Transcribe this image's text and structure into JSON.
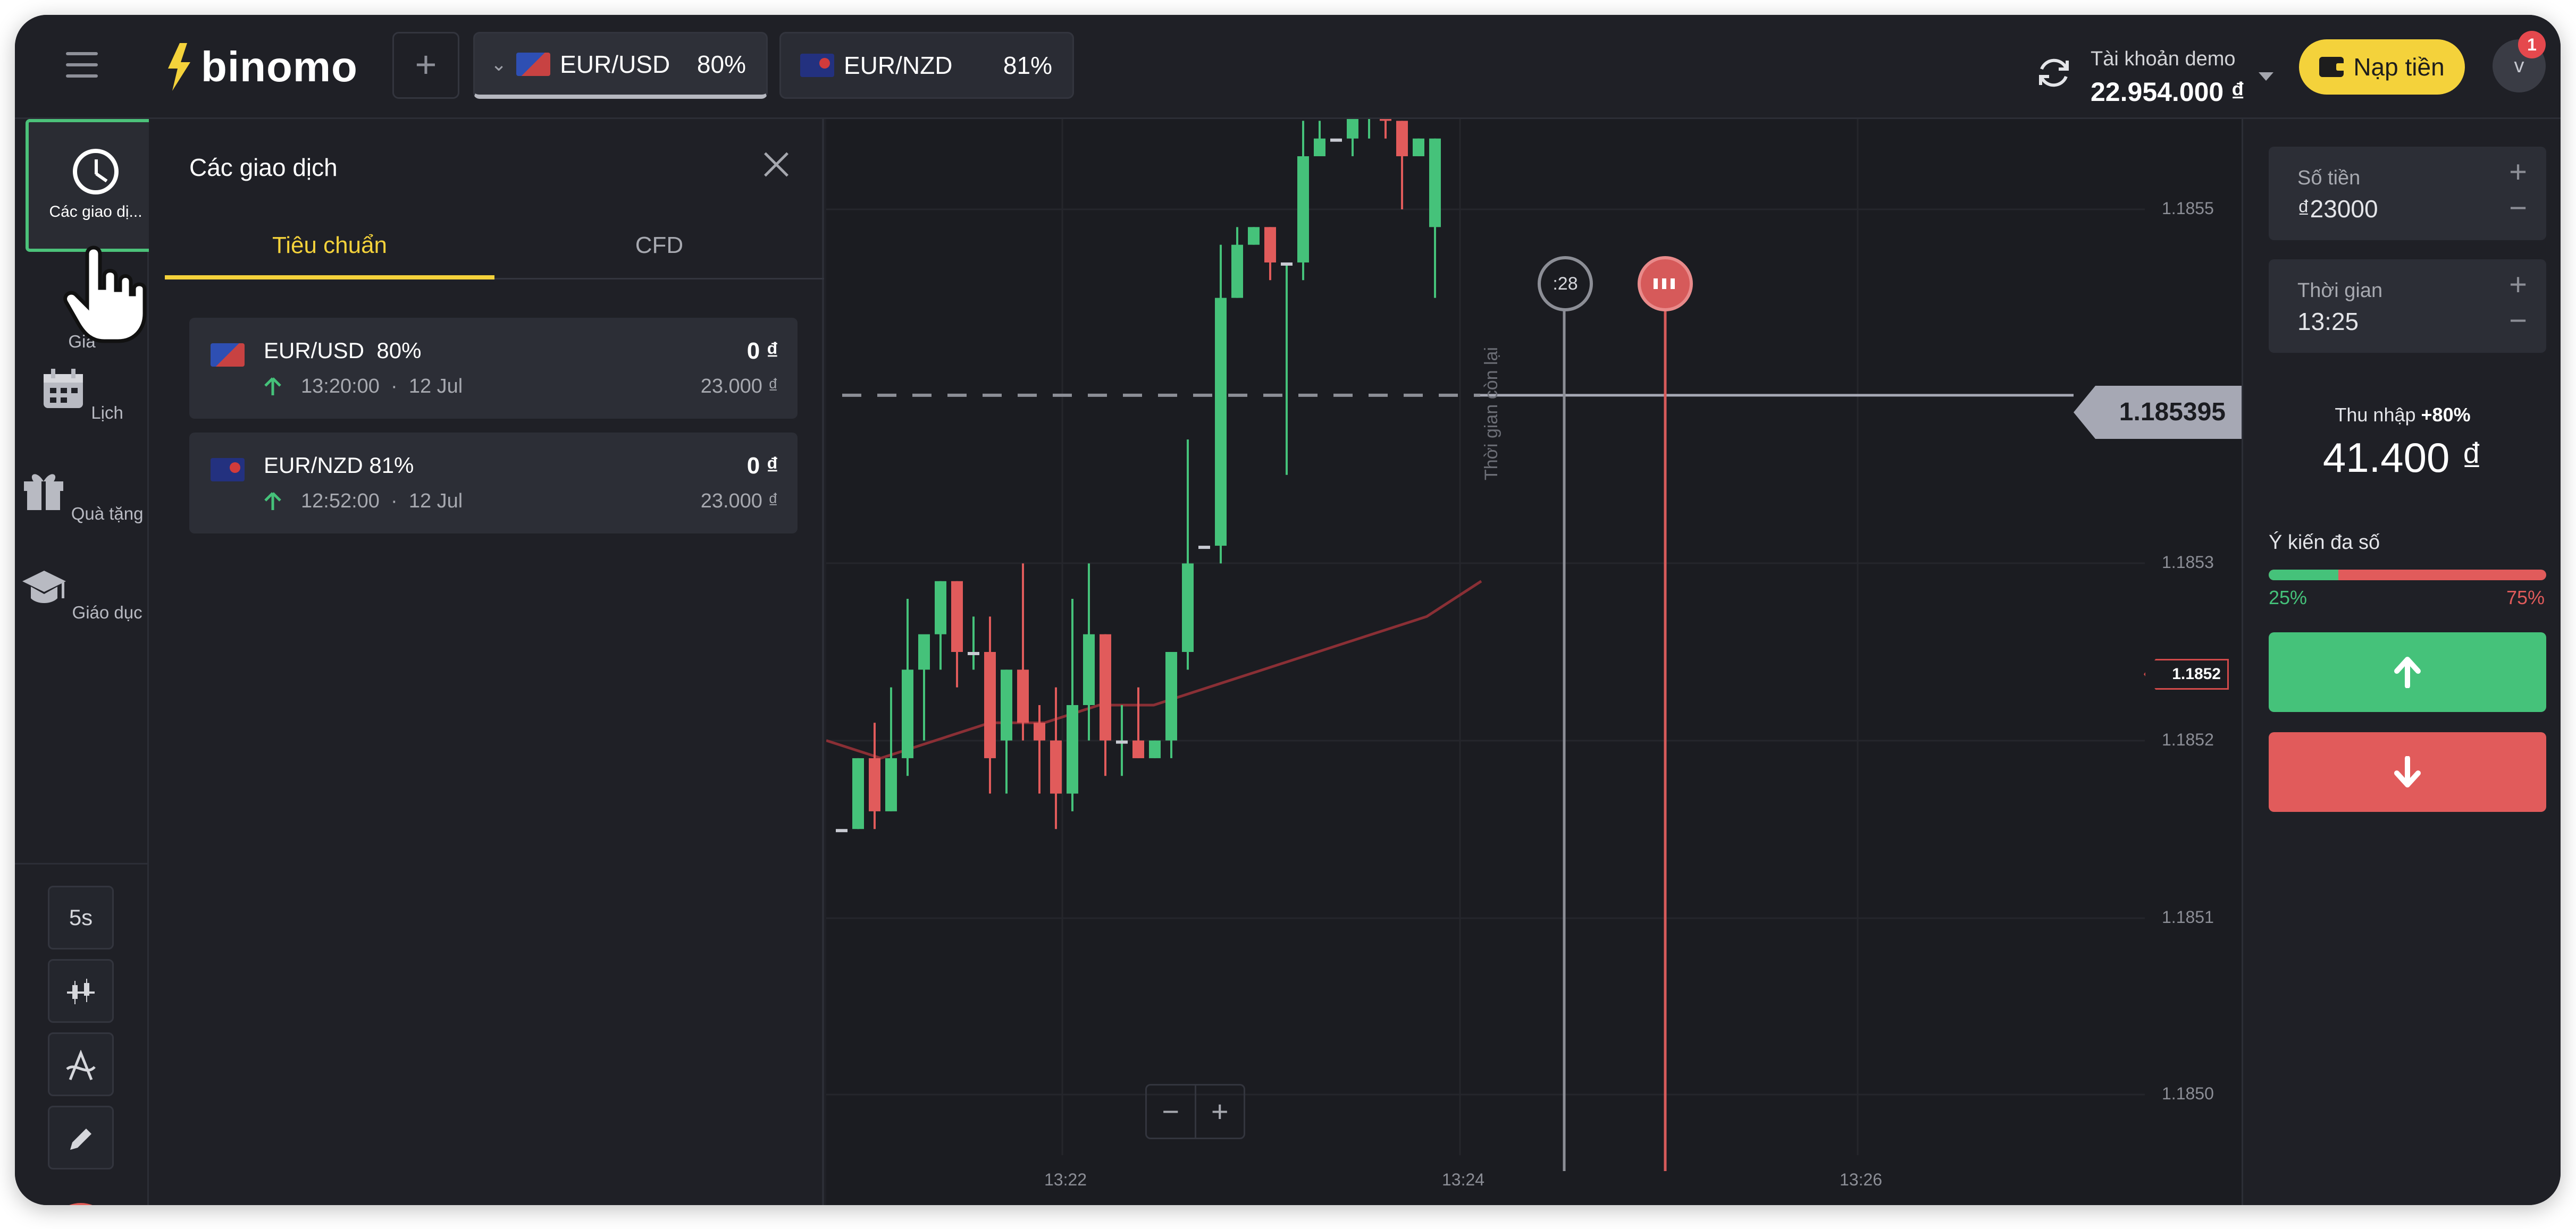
{
  "header": {
    "logo_text": "binomo",
    "add_tab_label": "+",
    "tabs": [
      {
        "asset": "EUR/USD",
        "payout": "80%",
        "active": true
      },
      {
        "asset": "EUR/NZD",
        "payout": "81%",
        "active": false
      }
    ],
    "account_label": "Tài khoản demo",
    "balance": "22.954.000 ₫",
    "deposit_label": "Nạp tiền",
    "avatar_initial": "v",
    "notification_count": "1"
  },
  "sidebar": {
    "active_item": "Các giao dị...",
    "items": [
      {
        "label": "Gia",
        "icon": "trades-icon"
      },
      {
        "label": "Lịch",
        "icon": "calendar-icon"
      },
      {
        "label": "Quà tặng",
        "icon": "gift-icon"
      },
      {
        "label": "Giáo dục",
        "icon": "education-icon"
      }
    ],
    "tools": [
      {
        "label": "5s",
        "icon": "timeframe"
      },
      {
        "label": "",
        "icon": "candles-icon"
      },
      {
        "label": "",
        "icon": "indicators-icon"
      },
      {
        "label": "",
        "icon": "pencil-icon"
      }
    ],
    "help_label": "?"
  },
  "trades_panel": {
    "title": "Các giao dịch",
    "tabs": [
      "Tiêu chuẩn",
      "CFD"
    ],
    "trades": [
      {
        "asset": "EUR/USD",
        "payout": "80%",
        "time": "13:20:00",
        "date": "12 Jul",
        "profit": "0 ₫",
        "amount": "23.000 ₫"
      },
      {
        "asset": "EUR/NZD",
        "payout": "81%",
        "time": "12:52:00",
        "date": "12 Jul",
        "profit": "0 ₫",
        "amount": "23.000 ₫"
      }
    ]
  },
  "chart": {
    "current_price": "1.185395",
    "ma_label": "1.1852",
    "y_labels": [
      "1.1855",
      "1.1853",
      "1.1852",
      "1.1851",
      "1.1850"
    ],
    "x_labels": [
      "13:22",
      "13:24",
      "13:26"
    ],
    "timer_badge": ":28",
    "timer_caption": "Thời gian còn lại",
    "zoom_out": "−",
    "zoom_in": "+",
    "colors": {
      "up": "#45c27a",
      "down": "#e15b5b",
      "ma": "#8a2f35"
    }
  },
  "chart_data": {
    "type": "candlestick",
    "y_ticks": [
      1.1855,
      1.1853,
      1.1852,
      1.1851,
      1.185
    ],
    "x_ticks": [
      "13:22",
      "13:24",
      "13:26"
    ],
    "candles": [
      {
        "o": 1.18515,
        "h": 1.18515,
        "l": 1.18515,
        "c": 1.18515
      },
      {
        "o": 1.18515,
        "h": 1.18519,
        "l": 1.18515,
        "c": 1.18519
      },
      {
        "o": 1.18519,
        "h": 1.18521,
        "l": 1.18515,
        "c": 1.18516
      },
      {
        "o": 1.18516,
        "h": 1.18523,
        "l": 1.18516,
        "c": 1.18519
      },
      {
        "o": 1.18519,
        "h": 1.18528,
        "l": 1.18518,
        "c": 1.18524
      },
      {
        "o": 1.18524,
        "h": 1.18525,
        "l": 1.1852,
        "c": 1.18526
      },
      {
        "o": 1.18526,
        "h": 1.18529,
        "l": 1.18524,
        "c": 1.18529
      },
      {
        "o": 1.18529,
        "h": 1.18529,
        "l": 1.18523,
        "c": 1.18525
      },
      {
        "o": 1.18525,
        "h": 1.18527,
        "l": 1.18524,
        "c": 1.18525
      },
      {
        "o": 1.18525,
        "h": 1.18527,
        "l": 1.18517,
        "c": 1.18519
      },
      {
        "o": 1.1852,
        "h": 1.18524,
        "l": 1.18517,
        "c": 1.18524
      },
      {
        "o": 1.18524,
        "h": 1.1853,
        "l": 1.1852,
        "c": 1.18521
      },
      {
        "o": 1.18521,
        "h": 1.18522,
        "l": 1.18517,
        "c": 1.1852
      },
      {
        "o": 1.1852,
        "h": 1.18523,
        "l": 1.18515,
        "c": 1.18517
      },
      {
        "o": 1.18517,
        "h": 1.18528,
        "l": 1.18516,
        "c": 1.18522
      },
      {
        "o": 1.18522,
        "h": 1.1853,
        "l": 1.1852,
        "c": 1.18526
      },
      {
        "o": 1.18526,
        "h": 1.18526,
        "l": 1.18518,
        "c": 1.1852
      },
      {
        "o": 1.1852,
        "h": 1.18522,
        "l": 1.18518,
        "c": 1.1852
      },
      {
        "o": 1.1852,
        "h": 1.18523,
        "l": 1.18519,
        "c": 1.18519
      },
      {
        "o": 1.18519,
        "h": 1.1852,
        "l": 1.18519,
        "c": 1.1852
      },
      {
        "o": 1.1852,
        "h": 1.18524,
        "l": 1.18519,
        "c": 1.18525
      },
      {
        "o": 1.18525,
        "h": 1.18537,
        "l": 1.18524,
        "c": 1.1853
      },
      {
        "o": 1.18531,
        "h": 1.18531,
        "l": 1.18531,
        "c": 1.18531
      },
      {
        "o": 1.18531,
        "h": 1.18548,
        "l": 1.1853,
        "c": 1.18545
      },
      {
        "o": 1.18545,
        "h": 1.18549,
        "l": 1.18545,
        "c": 1.18548
      },
      {
        "o": 1.18548,
        "h": 1.18549,
        "l": 1.18548,
        "c": 1.18549
      },
      {
        "o": 1.18549,
        "h": 1.18549,
        "l": 1.18546,
        "c": 1.18547
      },
      {
        "o": 1.18547,
        "h": 1.18547,
        "l": 1.18535,
        "c": 1.18547
      },
      {
        "o": 1.18547,
        "h": 1.18555,
        "l": 1.18546,
        "c": 1.18553
      },
      {
        "o": 1.18553,
        "h": 1.18555,
        "l": 1.18553,
        "c": 1.18554
      },
      {
        "o": 1.18554,
        "h": 1.18554,
        "l": 1.18554,
        "c": 1.18554
      },
      {
        "o": 1.18554,
        "h": 1.18556,
        "l": 1.18553,
        "c": 1.18556
      },
      {
        "o": 1.18556,
        "h": 1.18562,
        "l": 1.18554,
        "c": 1.18561
      },
      {
        "o": 1.18565,
        "h": 1.18567,
        "l": 1.18554,
        "c": 1.18555
      },
      {
        "o": 1.18555,
        "h": 1.18555,
        "l": 1.1855,
        "c": 1.18553
      },
      {
        "o": 1.18553,
        "h": 1.18554,
        "l": 1.18553,
        "c": 1.18554
      },
      {
        "o": 1.18549,
        "h": 1.18554,
        "l": 1.18545,
        "c": 1.18554
      }
    ],
    "moving_average": [
      1.1852,
      1.18519,
      1.1852,
      1.18521,
      1.18521,
      1.18522,
      1.18522,
      1.18523,
      1.18524,
      1.18525,
      1.18526,
      1.18527,
      1.18529
    ],
    "current_price": 1.185395
  },
  "trade_panel": {
    "amount_label": "Số tiền",
    "amount_value": "₫23000",
    "time_label": "Thời gian",
    "time_value": "13:25",
    "income_label": "Thu nhập",
    "income_pct": "+80%",
    "income_value": "41.400 ₫",
    "opinion_label": "Ý kiến đa số",
    "opinion_up": "25%",
    "opinion_down": "75%",
    "opinion_up_fraction": 0.25
  }
}
